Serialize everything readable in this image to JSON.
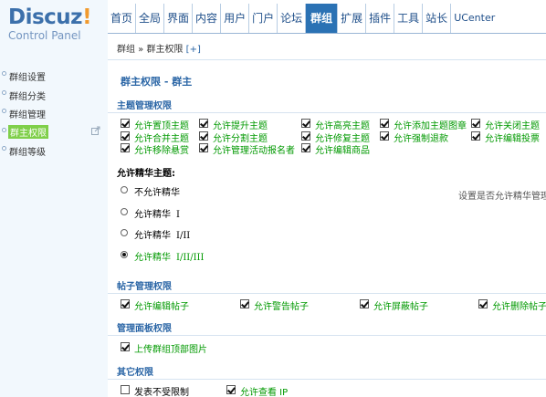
{
  "logo": {
    "brand": "Discuz",
    "bang": "!",
    "subtitle": "Control Panel"
  },
  "topnav": [
    "首页",
    "全局",
    "界面",
    "内容",
    "用户",
    "门户",
    "论坛",
    "群组",
    "扩展",
    "插件",
    "工具",
    "站长",
    "UCenter"
  ],
  "topnav_active": "群组",
  "breadcrumb": {
    "text": "群组 » 群主权限",
    "add": "[+]"
  },
  "sidebar": {
    "items": [
      {
        "label": "群组设置",
        "active": false
      },
      {
        "label": "群组分类",
        "active": false
      },
      {
        "label": "群组管理",
        "active": false
      },
      {
        "label": "群主权限",
        "active": true
      },
      {
        "label": "群组等级",
        "active": false
      }
    ]
  },
  "main": {
    "title": "群主权限 - 群主",
    "sections": {
      "topic": "主题管理权限",
      "digest": "允许精华主题:",
      "post": "帖子管理权限",
      "panel": "管理面板权限",
      "other": "其它权限"
    },
    "topic_perms": [
      "允许置顶主题",
      "允许提升主题",
      "允许高亮主题",
      "允许添加主题图章",
      "允许关闭主题",
      "允许合并主题",
      "允许分割主题",
      "允许修复主题",
      "允许强制退款",
      "允许编辑投票",
      "允许移除悬赏",
      "允许管理活动报名者",
      "允许编辑商品"
    ],
    "digest_options": [
      {
        "label": "不允许精华",
        "roman": "",
        "checked": false
      },
      {
        "label": "允许精华",
        "roman": "I",
        "checked": false
      },
      {
        "label": "允许精华",
        "roman": "I/II",
        "checked": false
      },
      {
        "label": "允许精华",
        "roman": "I/II/III",
        "checked": true
      }
    ],
    "digest_hint": "设置是否允许精华管理",
    "post_perms": [
      "允许编辑帖子",
      "允许警告帖子",
      "允许屏蔽帖子",
      "允许删除帖子"
    ],
    "panel_perms": [
      "上传群组顶部图片"
    ],
    "other_perms": [
      {
        "label": "发表不受限制",
        "checked": false
      },
      {
        "label": "允许查看 IP",
        "checked": true
      }
    ]
  },
  "colors": {
    "accent": "#2b72b4",
    "link": "#2b66a6",
    "granted": "#009900",
    "active_side": "#7fcf4a"
  },
  "icons": {
    "sidebar_ext": "external-link-icon"
  }
}
